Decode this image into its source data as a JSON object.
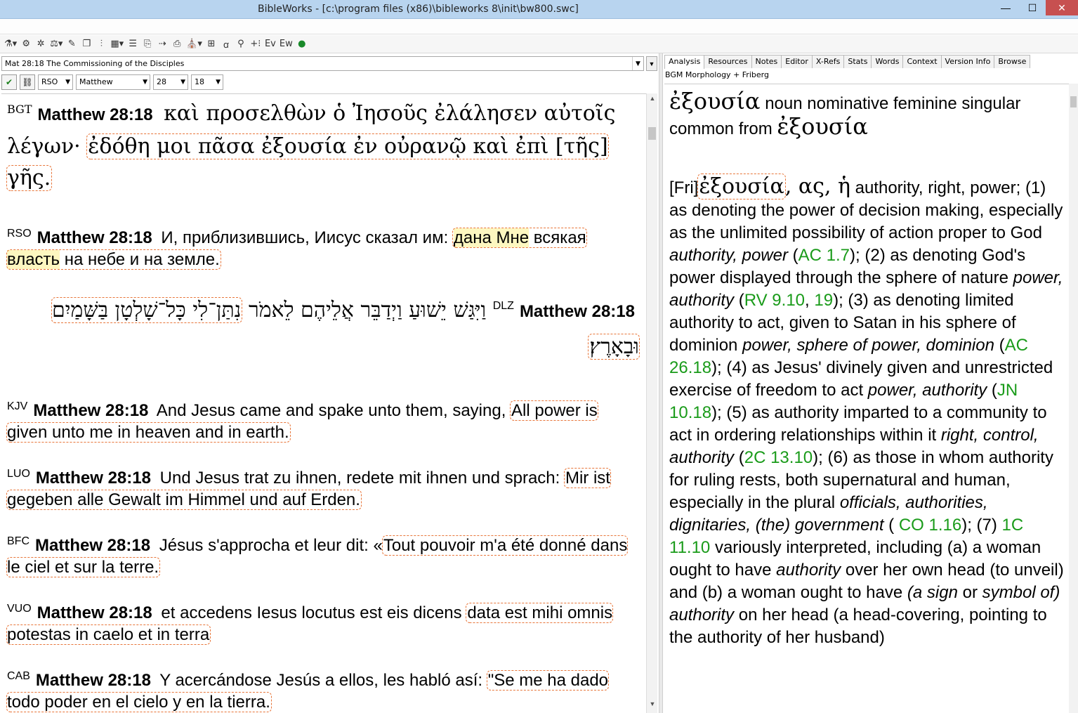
{
  "window": {
    "title": "BibleWorks - [c:\\program files (x86)\\bibleworks 8\\init\\bw800.swc]"
  },
  "window_controls": {
    "minimize": "—",
    "maximize": "☐",
    "close": "✕"
  },
  "toolbar_icons": [
    "ab-icon",
    "tools-icon",
    "puzzle-icon",
    "scale-icon",
    "highlighter-icon",
    "window-icon",
    "split-icon",
    "grid-icon",
    "columns-icon",
    "copy-icon",
    "export-icon",
    "print-icon",
    "bible-icon",
    "frame-icon",
    "text-icon",
    "find-icon",
    "plus-icon",
    "ev-icon",
    "ew-icon",
    "globe-icon"
  ],
  "reference_bar": {
    "value": "Mat 28:18 The Commissioning of the Disciples"
  },
  "selectors": {
    "version": "RSO",
    "book": "Matthew",
    "chapter": "28",
    "verse": "18"
  },
  "verses": [
    {
      "version": "BGT",
      "ref": "Matthew 28:18",
      "text": "καὶ προσελθὼν ὁ Ἰησοῦς ἐλάλησεν αὐτοῖς λέγων·",
      "highlight": "ἐδόθη μοι πᾶσα ἐξουσία ἐν οὐρανῷ καὶ ἐπὶ [τῆς] γῆς."
    },
    {
      "version": "RSO",
      "ref": "Matthew 28:18",
      "text": "И, приблизившись, Иисус сказал им:",
      "hl_yellow_1": "дана Мне",
      "hl_mid": " всякая ",
      "hl_yellow_2": "власть",
      "hl_rest": " на небе и на земле."
    },
    {
      "version": "DLZ",
      "ref": "Matthew 28:18",
      "text": "וַיִּגַּשׁ יֵשׁוּעַ וַיְדַבֵּר אֲלֵיהֶם לֵאמֹר",
      "highlight": "נִתַּן־לִי כָּל־שָׁלְטָן בַּשָּׁמַיִם וּבָאָרֶץ׃"
    },
    {
      "version": "KJV",
      "ref": "Matthew 28:18",
      "text": "And Jesus came and spake unto them, saying,",
      "highlight": "All power is given unto me in heaven and in earth."
    },
    {
      "version": "LUO",
      "ref": "Matthew 28:18",
      "text": "Und Jesus trat zu ihnen, redete mit ihnen und sprach:",
      "highlight": "Mir ist gegeben alle Gewalt im Himmel und auf Erden."
    },
    {
      "version": "BFC",
      "ref": "Matthew 28:18",
      "text": "Jésus s'approcha et leur dit: «",
      "highlight": "Tout pouvoir m'a été donné dans le ciel et sur la terre."
    },
    {
      "version": "VUO",
      "ref": "Matthew 28:18",
      "text": "et accedens Iesus locutus est eis dicens",
      "highlight": "data est mihi omnis potestas in caelo et in terra"
    },
    {
      "version": "CAB",
      "ref": "Matthew 28:18",
      "text": "Y acercándose Jesús a ellos, les habló así:",
      "highlight": "\"Se me ha dado todo poder en el cielo y en la tierra."
    }
  ],
  "tabs": [
    "Analysis",
    "Resources",
    "Notes",
    "Editor",
    "X-Refs",
    "Stats",
    "Words",
    "Context",
    "Version Info",
    "Browse"
  ],
  "analysis": {
    "source": "BGM Morphology + Friberg",
    "word": "ἐξουσία",
    "parse": "noun nominative feminine singular common from",
    "lemma": "ἐξουσία",
    "fri_tag": "[Fri]",
    "fri_word": "ἐξουσία",
    "fri_forms": ", ας, ἡ",
    "s1": " authority, right, power; (1) as denoting the power of decision making, especially as the unlimited possibility of action proper to God ",
    "i1": "authority, power",
    "r1": "AC 1.7",
    "s2": "); (2) as denoting God's power displayed through the sphere of nature ",
    "i2": "power, authority",
    "r2a": "RV 9.10",
    "r2b": "19",
    "s3": "); (3) as denoting limited authority to act, given to Satan in his sphere of dominion ",
    "i3": "power, sphere of power, dominion",
    "r3": "AC 26.18",
    "s4": "); (4) as Jesus' divinely given and unrestricted exercise of freedom to act ",
    "i4": "power, authority",
    "r4": "JN 10.18",
    "s5": "); (5) as authority imparted to a community to act in ordering relationships within it ",
    "i5": "right, control, authority",
    "r5": "2C 13.10",
    "s6": "); (6) as those in whom authority for ruling rests, both supernatural and human, especially in the plural ",
    "i6": "officials, authorities, dignitaries, (the) government",
    "r6": "CO 1.16",
    "s7": "); (7) ",
    "r7": "1C 11.10",
    "s8": " variously interpreted, including (a) a woman ought to have ",
    "i8": "authority",
    "s9": " over her own head (to unveil) and (b) a woman ought to have ",
    "i9a": "(a sign",
    "s10": " or ",
    "i9b": "symbol of) authority",
    "s11": " on her head (a head-covering, pointing to the authority of her husband)"
  }
}
